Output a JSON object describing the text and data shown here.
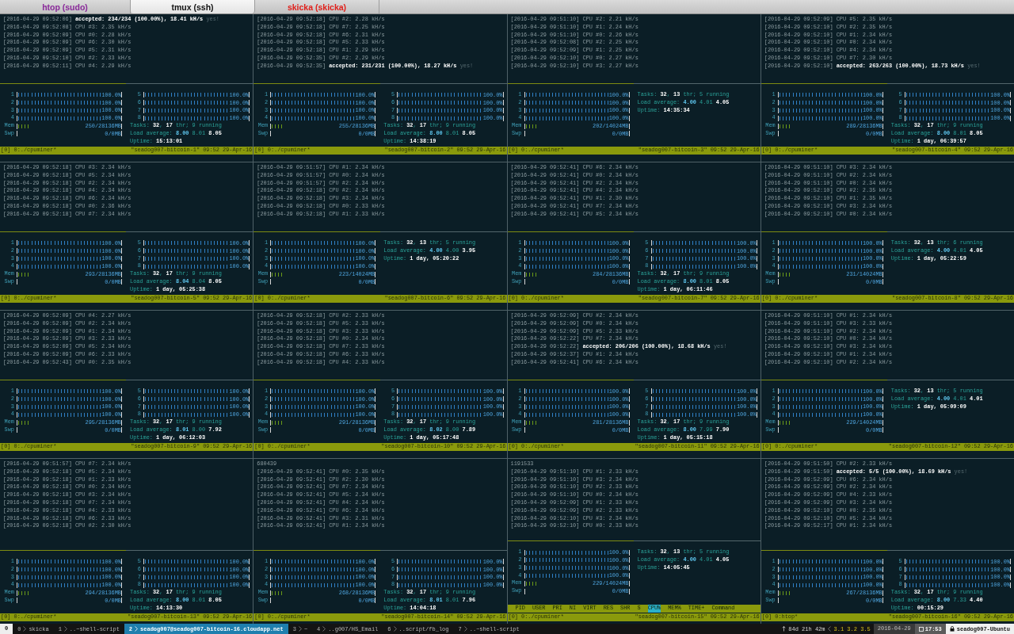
{
  "tabs": [
    {
      "label": "htop (sudo)",
      "selected": false,
      "color": "#8a2a9a"
    },
    {
      "label": "tmux (ssh)",
      "selected": true,
      "color": "#111111"
    },
    {
      "label": "skicka (skicka)",
      "selected": false,
      "color": "#e0201a"
    }
  ],
  "panes": [
    {
      "log": [
        {
          "kind": "accepted",
          "time": "[2016-04-29 09:52:06]",
          "text": "accepted: 234/234 (100.00%), 18.41 kH/s",
          "note": "yes!"
        },
        {
          "kind": "cpu",
          "text": "[2016-04-29 09:52:08] CPU #3: 2.35 kH/s"
        },
        {
          "kind": "cpu",
          "text": "[2016-04-29 09:52:09] CPU #0: 2.28 kH/s"
        },
        {
          "kind": "cpu",
          "text": "[2016-04-29 09:52:09] CPU #6: 2.30 kH/s"
        },
        {
          "kind": "cpu",
          "text": "[2016-04-29 09:52:09] CPU #5: 2.31 kH/s"
        },
        {
          "kind": "cpu",
          "text": "[2016-04-29 09:52:10] CPU #2: 2.33 kH/s"
        },
        {
          "kind": "cpu",
          "text": "[2016-04-29 09:52:11] CPU #4: 2.29 kH/s"
        }
      ],
      "cpus": [
        {
          "label": "1",
          "level": 1,
          "reading": "100.0%"
        },
        {
          "label": "2",
          "level": 1,
          "reading": "100.0%"
        },
        {
          "label": "3",
          "level": 1,
          "reading": "100.0%"
        },
        {
          "label": "4",
          "level": 1,
          "reading": "100.0%"
        },
        {
          "label": "5",
          "level": 1,
          "reading": "100.0%"
        },
        {
          "label": "6",
          "level": 1,
          "reading": "100.0%"
        },
        {
          "label": "7",
          "level": 1,
          "reading": "100.0%"
        },
        {
          "label": "8",
          "level": 1,
          "reading": "100.0%"
        }
      ],
      "mem": {
        "label": "Mem",
        "level": 0.12,
        "reading": "250/28136MB"
      },
      "swap": {
        "label": "Swp",
        "reading": "0/0MB"
      },
      "info": [
        "Tasks: **32**, **17** thr; 9 running",
        "Load average: **8.00** 8.01 **8.05**",
        "Uptime: **15:13:01**"
      ],
      "status_left": "[0] 0:./cpuminer*",
      "status_right": "\"seadog007-bitcoin-1\" 09:52 29-Apr-16"
    },
    {
      "log": [
        {
          "kind": "cpu",
          "text": "[2016-04-29 09:52:18] CPU #2: 2.28 kH/s"
        },
        {
          "kind": "cpu",
          "text": "[2016-04-29 09:52:18] CPU #7: 2.25 kH/s"
        },
        {
          "kind": "cpu",
          "text": "[2016-04-29 09:52:18] CPU #6: 2.31 kH/s"
        },
        {
          "kind": "cpu",
          "text": "[2016-04-29 09:52:18] CPU #5: 2.33 kH/s"
        },
        {
          "kind": "cpu",
          "text": "[2016-04-29 09:52:18] CPU #1: 2.29 kH/s"
        },
        {
          "kind": "cpu",
          "text": "[2016-04-29 09:52:35] CPU #2: 2.29 kH/s"
        },
        {
          "kind": "accepted",
          "time": "[2016-04-29 09:52:35]",
          "text": "accepted: 231/231 (100.00%), 18.27 kH/s",
          "note": "yes!"
        }
      ],
      "cpus": [
        {
          "label": "1",
          "level": 1,
          "reading": "100.0%"
        },
        {
          "label": "2",
          "level": 1,
          "reading": "100.0%"
        },
        {
          "label": "3",
          "level": 1,
          "reading": "100.0%"
        },
        {
          "label": "4",
          "level": 1,
          "reading": "100.0%"
        },
        {
          "label": "5",
          "level": 1,
          "reading": "100.0%"
        },
        {
          "label": "6",
          "level": 1,
          "reading": "100.0%"
        },
        {
          "label": "7",
          "level": 1,
          "reading": "100.0%"
        },
        {
          "label": "8",
          "level": 1,
          "reading": "100.0%"
        }
      ],
      "mem": {
        "label": "Mem",
        "level": 0.12,
        "reading": "255/28136MB"
      },
      "swap": {
        "label": "Swp",
        "reading": "0/0MB"
      },
      "info": [
        "Tasks: **32**, **17** thr; 9 running",
        "Load average: **8.00** 8.01 **8.05**",
        "Uptime: **14:38:19**"
      ],
      "status_left": "[0] 0:./cpuminer*",
      "status_right": "\"seadog007-bitcoin-2\" 09:52 29-Apr-16"
    },
    {
      "log": [
        {
          "kind": "cpu",
          "text": "[2016-04-29 09:51:10] CPU #2: 2.21 kH/s"
        },
        {
          "kind": "cpu",
          "text": "[2016-04-29 09:51:10] CPU #1: 2.24 kH/s"
        },
        {
          "kind": "cpu",
          "text": "[2016-04-29 09:51:10] CPU #0: 2.26 kH/s"
        },
        {
          "kind": "cpu",
          "text": "[2016-04-29 09:52:08] CPU #2: 2.25 kH/s"
        },
        {
          "kind": "cpu",
          "text": "[2016-04-29 09:52:09] CPU #1: 2.25 kH/s"
        },
        {
          "kind": "cpu",
          "text": "[2016-04-29 09:52:10] CPU #0: 2.27 kH/s"
        },
        {
          "kind": "cpu",
          "text": "[2016-04-29 09:52:10] CPU #3: 2.27 kH/s"
        }
      ],
      "cpus": [
        {
          "label": "1",
          "level": 1,
          "reading": "100.0%"
        },
        {
          "label": "2",
          "level": 1,
          "reading": "100.0%"
        },
        {
          "label": "3",
          "level": 1,
          "reading": "100.0%"
        },
        {
          "label": "4",
          "level": 1,
          "reading": "100.0%"
        }
      ],
      "mem": {
        "label": "Mem",
        "level": 0.12,
        "reading": "202/14024MB"
      },
      "swap": {
        "label": "Swp",
        "reading": "0/0MB"
      },
      "info": [
        "Tasks: **32**, **13** thr; 5 running",
        "Load average: **4.00** 4.01 **4.05**",
        "Uptime: **14:35:34**"
      ],
      "status_left": "[0] 0:./cpuminer*",
      "status_right": "\"seadog007-bitcoin-3\" 09:52 29-Apr-16"
    },
    {
      "log": [
        {
          "kind": "cpu",
          "text": "[2016-04-29 09:52:09] CPU #5: 2.35 kH/s"
        },
        {
          "kind": "cpu",
          "text": "[2016-04-29 09:52:10] CPU #2: 2.35 kH/s"
        },
        {
          "kind": "cpu",
          "text": "[2016-04-29 09:52:10] CPU #1: 2.34 kH/s"
        },
        {
          "kind": "cpu",
          "text": "[2016-04-29 09:52:10] CPU #0: 2.34 kH/s"
        },
        {
          "kind": "cpu",
          "text": "[2016-04-29 09:52:10] CPU #4: 2.34 kH/s"
        },
        {
          "kind": "cpu",
          "text": "[2016-04-29 09:52:10] CPU #7: 2.30 kH/s"
        },
        {
          "kind": "accepted",
          "time": "[2016-04-29 09:52:10]",
          "text": "accepted: 263/263 (100.00%), 18.73 kH/s",
          "note": "yes!"
        }
      ],
      "cpus": [
        {
          "label": "1",
          "level": 1,
          "reading": "100.0%"
        },
        {
          "label": "2",
          "level": 1,
          "reading": "100.0%"
        },
        {
          "label": "3",
          "level": 1,
          "reading": "100.0%"
        },
        {
          "label": "4",
          "level": 1,
          "reading": "100.0%"
        },
        {
          "label": "5",
          "level": 1,
          "reading": "100.0%"
        },
        {
          "label": "6",
          "level": 1,
          "reading": "100.0%"
        },
        {
          "label": "7",
          "level": 1,
          "reading": "100.0%"
        },
        {
          "label": "8",
          "level": 1,
          "reading": "100.0%"
        }
      ],
      "mem": {
        "label": "Mem",
        "level": 0.12,
        "reading": "289/28136MB"
      },
      "swap": {
        "label": "Swp",
        "reading": "0/0MB"
      },
      "info": [
        "Tasks: **32**, **17** thr; 9 running",
        "Load average: **8.00** 8.01 **8.05**",
        "Uptime: **1 day, 06:39:57**"
      ],
      "status_left": "[0] 0:./cpuminer*",
      "status_right": "\"seadog007-bitcoin-4\" 09:52 29-Apr-16"
    },
    {
      "log": [
        {
          "kind": "cpu",
          "text": "[2016-04-29 09:52:18] CPU #3: 2.34 kH/s"
        },
        {
          "kind": "cpu",
          "text": "[2016-04-29 09:52:18] CPU #5: 2.34 kH/s"
        },
        {
          "kind": "cpu",
          "text": "[2016-04-29 09:52:18] CPU #2: 2.34 kH/s"
        },
        {
          "kind": "cpu",
          "text": "[2016-04-29 09:52:18] CPU #4: 2.34 kH/s"
        },
        {
          "kind": "cpu",
          "text": "[2016-04-29 09:52:18] CPU #6: 2.34 kH/s"
        },
        {
          "kind": "cpu",
          "text": "[2016-04-29 09:52:18] CPU #0: 2.36 kH/s"
        },
        {
          "kind": "cpu",
          "text": "[2016-04-29 09:52:18] CPU #7: 2.34 kH/s"
        }
      ],
      "cpus": [
        {
          "label": "1",
          "level": 1,
          "reading": "100.0%"
        },
        {
          "label": "2",
          "level": 1,
          "reading": "100.0%"
        },
        {
          "label": "3",
          "level": 1,
          "reading": "100.0%"
        },
        {
          "label": "4",
          "level": 1,
          "reading": "100.0%"
        },
        {
          "label": "5",
          "level": 1,
          "reading": "100.0%"
        },
        {
          "label": "6",
          "level": 1,
          "reading": "100.0%"
        },
        {
          "label": "7",
          "level": 1,
          "reading": "100.0%"
        },
        {
          "label": "8",
          "level": 1,
          "reading": "100.0%"
        }
      ],
      "mem": {
        "label": "Mem",
        "level": 0.12,
        "reading": "293/28136MB"
      },
      "swap": {
        "label": "Swp",
        "reading": "0/0MB"
      },
      "info": [
        "Tasks: **32**, **17** thr; 9 running",
        "Load average: **8.04** 8.04 **8.05**",
        "Uptime: **1 day, 05:25:38**"
      ],
      "status_left": "[0] 0:./cpuminer*",
      "status_right": "\"seadog007-bitcoin-5\" 09:52 29-Apr-16"
    },
    {
      "log": [
        {
          "kind": "cpu",
          "text": "[2016-04-29 09:51:57] CPU #1: 2.34 kH/s"
        },
        {
          "kind": "cpu",
          "text": "[2016-04-29 09:51:57] CPU #0: 2.34 kH/s"
        },
        {
          "kind": "cpu",
          "text": "[2016-04-29 09:51:57] CPU #2: 2.34 kH/s"
        },
        {
          "kind": "cpu",
          "text": "[2016-04-29 09:52:18] CPU #2: 2.34 kH/s"
        },
        {
          "kind": "cpu",
          "text": "[2016-04-29 09:52:18] CPU #3: 2.34 kH/s"
        },
        {
          "kind": "cpu",
          "text": "[2016-04-29 09:52:18] CPU #0: 2.33 kH/s"
        },
        {
          "kind": "cpu",
          "text": "[2016-04-29 09:52:18] CPU #1: 2.33 kH/s"
        }
      ],
      "cpus": [
        {
          "label": "1",
          "level": 1,
          "reading": "100.0%"
        },
        {
          "label": "2",
          "level": 1,
          "reading": "100.0%"
        },
        {
          "label": "3",
          "level": 1,
          "reading": "100.0%"
        },
        {
          "label": "4",
          "level": 1,
          "reading": "100.0%"
        }
      ],
      "mem": {
        "label": "Mem",
        "level": 0.12,
        "reading": "223/14024MB"
      },
      "swap": {
        "label": "Swp",
        "reading": "0/0MB"
      },
      "info": [
        "Tasks: **32**, **13** thr; 5 running",
        "Load average: **4.00** 4.00 **3.95**",
        "Uptime: **1 day, 05:20:22**"
      ],
      "status_left": "[0] 0:./cpuminer*",
      "status_right": "\"seadog007-bitcoin-6\" 09:52 29-Apr-16"
    },
    {
      "log": [
        {
          "kind": "cpu",
          "text": "[2016-04-29 09:52:41] CPU #6: 2.34 kH/s"
        },
        {
          "kind": "cpu",
          "text": "[2016-04-29 09:52:41] CPU #0: 2.34 kH/s"
        },
        {
          "kind": "cpu",
          "text": "[2016-04-29 09:52:41] CPU #2: 2.34 kH/s"
        },
        {
          "kind": "cpu",
          "text": "[2016-04-29 09:52:41] CPU #4: 2.34 kH/s"
        },
        {
          "kind": "cpu",
          "text": "[2016-04-29 09:52:41] CPU #1: 2.30 kH/s"
        },
        {
          "kind": "cpu",
          "text": "[2016-04-29 09:52:41] CPU #7: 2.34 kH/s"
        },
        {
          "kind": "cpu",
          "text": "[2016-04-29 09:52:41] CPU #5: 2.34 kH/s"
        }
      ],
      "cpus": [
        {
          "label": "1",
          "level": 1,
          "reading": "100.0%"
        },
        {
          "label": "2",
          "level": 1,
          "reading": "100.0%"
        },
        {
          "label": "3",
          "level": 1,
          "reading": "100.0%"
        },
        {
          "label": "4",
          "level": 1,
          "reading": "100.0%"
        },
        {
          "label": "5",
          "level": 1,
          "reading": "100.0%"
        },
        {
          "label": "6",
          "level": 1,
          "reading": "100.0%"
        },
        {
          "label": "7",
          "level": 1,
          "reading": "100.0%"
        },
        {
          "label": "8",
          "level": 1,
          "reading": "100.0%"
        }
      ],
      "mem": {
        "label": "Mem",
        "level": 0.12,
        "reading": "284/28136MB"
      },
      "swap": {
        "label": "Swp",
        "reading": "0/0MB"
      },
      "info": [
        "Tasks: **32**, **17** thr; 9 running",
        "Load average: **8.00** 8.01 **8.05**",
        "Uptime: **1 day, 06:11:46**"
      ],
      "status_left": "[0] 0:./cpuminer*",
      "status_right": "\"seadog007-bitcoin-7\" 09:52 29-Apr-16"
    },
    {
      "log": [
        {
          "kind": "cpu",
          "text": "[2016-04-29 09:51:10] CPU #3: 2.34 kH/s"
        },
        {
          "kind": "cpu",
          "text": "[2016-04-29 09:51:10] CPU #2: 2.34 kH/s"
        },
        {
          "kind": "cpu",
          "text": "[2016-04-29 09:51:10] CPU #0: 2.34 kH/s"
        },
        {
          "kind": "cpu",
          "text": "[2016-04-29 09:52:10] CPU #2: 2.35 kH/s"
        },
        {
          "kind": "cpu",
          "text": "[2016-04-29 09:52:10] CPU #1: 2.35 kH/s"
        },
        {
          "kind": "cpu",
          "text": "[2016-04-29 09:52:10] CPU #3: 2.34 kH/s"
        },
        {
          "kind": "cpu",
          "text": "[2016-04-29 09:52:10] CPU #0: 2.34 kH/s"
        }
      ],
      "cpus": [
        {
          "label": "1",
          "level": 1,
          "reading": "100.0%"
        },
        {
          "label": "2",
          "level": 1,
          "reading": "100.0%"
        },
        {
          "label": "3",
          "level": 1,
          "reading": "100.0%"
        },
        {
          "label": "4",
          "level": 1,
          "reading": "100.0%"
        }
      ],
      "mem": {
        "label": "Mem",
        "level": 0.12,
        "reading": "231/14024MB"
      },
      "swap": {
        "label": "Swp",
        "reading": "0/0MB"
      },
      "info": [
        "Tasks: **32**, **13** thr; 6 running",
        "Load average: **4.00** 4.01 **4.05**",
        "Uptime: **1 day, 05:22:59**"
      ],
      "status_left": "[0] 0:./cpuminer*",
      "status_right": "\"seadog007-bitcoin-8\" 09:52 29-Apr-16"
    },
    {
      "log": [
        {
          "kind": "cpu",
          "text": "[2016-04-29 09:52:09] CPU #4: 2.27 kH/s"
        },
        {
          "kind": "cpu",
          "text": "[2016-04-29 09:52:09] CPU #2: 2.34 kH/s"
        },
        {
          "kind": "cpu",
          "text": "[2016-04-29 09:52:09] CPU #1: 2.34 kH/s"
        },
        {
          "kind": "cpu",
          "text": "[2016-04-29 09:52:09] CPU #3: 2.33 kH/s"
        },
        {
          "kind": "cpu",
          "text": "[2016-04-29 09:52:09] CPU #5: 2.34 kH/s"
        },
        {
          "kind": "cpu",
          "text": "[2016-04-29 09:52:09] CPU #6: 2.33 kH/s"
        },
        {
          "kind": "cpu",
          "text": "[2016-04-29 09:52:43] CPU #0: 2.35 kH/s"
        }
      ],
      "cpus": [
        {
          "label": "1",
          "level": 1,
          "reading": "100.0%"
        },
        {
          "label": "2",
          "level": 1,
          "reading": "100.0%"
        },
        {
          "label": "3",
          "level": 1,
          "reading": "100.0%"
        },
        {
          "label": "4",
          "level": 1,
          "reading": "100.0%"
        },
        {
          "label": "5",
          "level": 1,
          "reading": "100.0%"
        },
        {
          "label": "6",
          "level": 1,
          "reading": "100.0%"
        },
        {
          "label": "7",
          "level": 1,
          "reading": "100.0%"
        },
        {
          "label": "8",
          "level": 1,
          "reading": "100.0%"
        }
      ],
      "mem": {
        "label": "Mem",
        "level": 0.12,
        "reading": "295/28136MB"
      },
      "swap": {
        "label": "Swp",
        "reading": "0/0MB"
      },
      "info": [
        "Tasks: **32**, **17** thr; 9 running",
        "Load average: **8.01** 8.00 **7.92**",
        "Uptime: **1 day, 06:12:03**"
      ],
      "status_left": "[0] 0:./cpuminer*",
      "status_right": "\"seadog007-bitcoin-9\" 09:52 29-Apr-16"
    },
    {
      "log": [
        {
          "kind": "cpu",
          "text": "[2016-04-29 09:52:18] CPU #2: 2.33 kH/s"
        },
        {
          "kind": "cpu",
          "text": "[2016-04-29 09:52:18] CPU #5: 2.33 kH/s"
        },
        {
          "kind": "cpu",
          "text": "[2016-04-29 09:52:18] CPU #3: 2.33 kH/s"
        },
        {
          "kind": "cpu",
          "text": "[2016-04-29 09:52:18] CPU #0: 2.34 kH/s"
        },
        {
          "kind": "cpu",
          "text": "[2016-04-29 09:52:18] CPU #7: 2.33 kH/s"
        },
        {
          "kind": "cpu",
          "text": "[2016-04-29 09:52:18] CPU #6: 2.33 kH/s"
        },
        {
          "kind": "cpu",
          "text": "[2016-04-29 09:52:18] CPU #4: 2.33 kH/s"
        }
      ],
      "cpus": [
        {
          "label": "1",
          "level": 1,
          "reading": "100.0%"
        },
        {
          "label": "2",
          "level": 1,
          "reading": "100.0%"
        },
        {
          "label": "3",
          "level": 1,
          "reading": "100.0%"
        },
        {
          "label": "4",
          "level": 1,
          "reading": "100.0%"
        },
        {
          "label": "5",
          "level": 1,
          "reading": "100.0%"
        },
        {
          "label": "6",
          "level": 1,
          "reading": "100.0%"
        },
        {
          "label": "7",
          "level": 1,
          "reading": "100.0%"
        },
        {
          "label": "8",
          "level": 1,
          "reading": "100.0%"
        }
      ],
      "mem": {
        "label": "Mem",
        "level": 0.12,
        "reading": "291/28136MB"
      },
      "swap": {
        "label": "Swp",
        "reading": "0/0MB"
      },
      "info": [
        "Tasks: **32**, **17** thr; 9 running",
        "Load average: **8.02** 8.00 **7.89**",
        "Uptime: **1 day, 05:17:48**"
      ],
      "status_left": "[0] 0:./cpuminer*",
      "status_right": "\"seadog007-bitcoin-10\" 09:52 29-Apr-16"
    },
    {
      "log": [
        {
          "kind": "cpu",
          "text": "[2016-04-29 09:52:09] CPU #2: 2.34 kH/s"
        },
        {
          "kind": "cpu",
          "text": "[2016-04-29 09:52:09] CPU #0: 2.34 kH/s"
        },
        {
          "kind": "cpu",
          "text": "[2016-04-29 09:52:09] CPU #5: 2.33 kH/s"
        },
        {
          "kind": "cpu",
          "text": "[2016-04-29 09:52:22] CPU #7: 2.34 kH/s"
        },
        {
          "kind": "accepted",
          "time": "[2016-04-29 09:52:22]",
          "text": "accepted: 206/206 (100.00%), 18.68 kH/s",
          "note": "yes!"
        },
        {
          "kind": "cpu",
          "text": "[2016-04-29 09:52:37] CPU #1: 2.34 kH/s"
        },
        {
          "kind": "cpu",
          "text": "[2016-04-29 09:52:41] CPU #6: 2.34 kH/s"
        }
      ],
      "cpus": [
        {
          "label": "1",
          "level": 1,
          "reading": "100.0%"
        },
        {
          "label": "2",
          "level": 1,
          "reading": "100.0%"
        },
        {
          "label": "3",
          "level": 1,
          "reading": "100.0%"
        },
        {
          "label": "4",
          "level": 1,
          "reading": "100.0%"
        },
        {
          "label": "5",
          "level": 1,
          "reading": "100.0%"
        },
        {
          "label": "6",
          "level": 1,
          "reading": "100.0%"
        },
        {
          "label": "7",
          "level": 1,
          "reading": "100.0%"
        },
        {
          "label": "8",
          "level": 1,
          "reading": "100.0%"
        }
      ],
      "mem": {
        "label": "Mem",
        "level": 0.12,
        "reading": "281/28136MB"
      },
      "swap": {
        "label": "Swp",
        "reading": "0/0MB"
      },
      "info": [
        "Tasks: **32**, **17** thr; 9 running",
        "Load average: **8.00** 7.99 **7.90**",
        "Uptime: **1 day, 05:15:18**"
      ],
      "status_left": "[0] 0:./cpuminer*",
      "status_right": "\"seadog007-bitcoin-11\" 09:52 29-Apr-16"
    },
    {
      "log": [
        {
          "kind": "cpu",
          "text": "[2016-04-29 09:51:10] CPU #1: 2.34 kH/s"
        },
        {
          "kind": "cpu",
          "text": "[2016-04-29 09:51:10] CPU #3: 2.33 kH/s"
        },
        {
          "kind": "cpu",
          "text": "[2016-04-29 09:51:10] CPU #2: 2.34 kH/s"
        },
        {
          "kind": "cpu",
          "text": "[2016-04-29 09:52:10] CPU #0: 2.34 kH/s"
        },
        {
          "kind": "cpu",
          "text": "[2016-04-29 09:52:10] CPU #3: 2.34 kH/s"
        },
        {
          "kind": "cpu",
          "text": "[2016-04-29 09:52:10] CPU #1: 2.34 kH/s"
        },
        {
          "kind": "cpu",
          "text": "[2016-04-29 09:52:10] CPU #2: 2.34 kH/s"
        }
      ],
      "cpus": [
        {
          "label": "1",
          "level": 1,
          "reading": "100.0%"
        },
        {
          "label": "2",
          "level": 1,
          "reading": "100.0%"
        },
        {
          "label": "3",
          "level": 1,
          "reading": "100.0%"
        },
        {
          "label": "4",
          "level": 1,
          "reading": "100.0%"
        }
      ],
      "mem": {
        "label": "Mem",
        "level": 0.12,
        "reading": "229/14024MB"
      },
      "swap": {
        "label": "Swp",
        "reading": "0/0MB"
      },
      "info": [
        "Tasks: **32**, **13** thr; 5 running",
        "Load average: **4.00** 4.01 **4.01**",
        "Uptime: **1 day, 05:09:09**"
      ],
      "status_left": "[0] 0:./cpuminer*",
      "status_right": "\"seadog007-bitcoin-12\" 09:52 29-Apr-16"
    },
    {
      "log": [
        {
          "kind": "cpu",
          "text": "[2016-04-29 09:51:57] CPU #7: 2.34 kH/s"
        },
        {
          "kind": "cpu",
          "text": "[2016-04-29 09:52:18] CPU #5: 2.34 kH/s"
        },
        {
          "kind": "cpu",
          "text": "[2016-04-29 09:52:18] CPU #1: 2.33 kH/s"
        },
        {
          "kind": "cpu",
          "text": "[2016-04-29 09:52:18] CPU #0: 2.34 kH/s"
        },
        {
          "kind": "cpu",
          "text": "[2016-04-29 09:52:18] CPU #3: 2.34 kH/s"
        },
        {
          "kind": "cpu",
          "text": "[2016-04-29 09:52:18] CPU #7: 2.34 kH/s"
        },
        {
          "kind": "cpu",
          "text": "[2016-04-29 09:52:18] CPU #4: 2.33 kH/s"
        },
        {
          "kind": "cpu",
          "text": "[2016-04-29 09:52:18] CPU #6: 2.33 kH/s"
        },
        {
          "kind": "cpu",
          "text": "[2016-04-29 09:52:18] CPU #2: 2.30 kH/s"
        }
      ],
      "cpus": [
        {
          "label": "1",
          "level": 1,
          "reading": "100.0%"
        },
        {
          "label": "2",
          "level": 1,
          "reading": "100.0%"
        },
        {
          "label": "3",
          "level": 1,
          "reading": "100.0%"
        },
        {
          "label": "4",
          "level": 1,
          "reading": "100.0%"
        },
        {
          "label": "5",
          "level": 1,
          "reading": "100.0%"
        },
        {
          "label": "6",
          "level": 1,
          "reading": "100.0%"
        },
        {
          "label": "7",
          "level": 1,
          "reading": "100.0%"
        },
        {
          "label": "8",
          "level": 1,
          "reading": "100.0%"
        }
      ],
      "mem": {
        "label": "Mem",
        "level": 0.12,
        "reading": "294/28136MB"
      },
      "swap": {
        "label": "Swp",
        "reading": "0/0MB"
      },
      "info": [
        "Tasks: **32**, **17** thr; 9 running",
        "Load average: **8.00** 8.01 **8.05**",
        "Uptime: **14:13:30**"
      ],
      "status_left": "[0] 0:./cpuminer*",
      "status_right": "\"seadog007-bitcoin-13\" 09:52 29-Apr-16"
    },
    {
      "log": [
        {
          "kind": "plain",
          "text": "680439"
        },
        {
          "kind": "cpu",
          "text": "[2016-04-29 09:52:41] CPU #0: 2.35 kH/s"
        },
        {
          "kind": "cpu",
          "text": "[2016-04-29 09:52:41] CPU #2: 2.30 kH/s"
        },
        {
          "kind": "cpu",
          "text": "[2016-04-29 09:52:41] CPU #7: 2.34 kH/s"
        },
        {
          "kind": "cpu",
          "text": "[2016-04-29 09:52:41] CPU #5: 2.34 kH/s"
        },
        {
          "kind": "cpu",
          "text": "[2016-04-29 09:52:41] CPU #4: 2.34 kH/s"
        },
        {
          "kind": "cpu",
          "text": "[2016-04-29 09:52:41] CPU #6: 2.34 kH/s"
        },
        {
          "kind": "cpu",
          "text": "[2016-04-29 09:52:41] CPU #3: 2.31 kH/s"
        },
        {
          "kind": "cpu",
          "text": "[2016-04-29 09:52:41] CPU #1: 2.34 kH/s"
        }
      ],
      "cpus": [
        {
          "label": "1",
          "level": 1,
          "reading": "100.0%"
        },
        {
          "label": "2",
          "level": 1,
          "reading": "100.0%"
        },
        {
          "label": "3",
          "level": 1,
          "reading": "100.0%"
        },
        {
          "label": "4",
          "level": 1,
          "reading": "100.0%"
        },
        {
          "label": "5",
          "level": 1,
          "reading": "100.0%"
        },
        {
          "label": "6",
          "level": 1,
          "reading": "100.0%"
        },
        {
          "label": "7",
          "level": 1,
          "reading": "100.0%"
        },
        {
          "label": "8",
          "level": 1,
          "reading": "100.0%"
        }
      ],
      "mem": {
        "label": "Mem",
        "level": 0.12,
        "reading": "268/28136MB"
      },
      "swap": {
        "label": "Swp",
        "reading": "0/0MB"
      },
      "info": [
        "Tasks: **32**, **17** thr; 9 running",
        "Load average: **8.01** 8.01 **7.96**",
        "Uptime: **14:04:18**"
      ],
      "status_left": "[0] 0:./cpuminer*",
      "status_right": "\"seadog007-bitcoin-14\" 09:52 29-Apr-16"
    },
    {
      "log": [
        {
          "kind": "plain",
          "text": "1191533"
        },
        {
          "kind": "cpu",
          "text": "[2016-04-29 09:51:10] CPU #1: 2.33 kH/s"
        },
        {
          "kind": "cpu",
          "text": "[2016-04-29 09:51:10] CPU #3: 2.34 kH/s"
        },
        {
          "kind": "cpu",
          "text": "[2016-04-29 09:51:10] CPU #2: 2.33 kH/s"
        },
        {
          "kind": "cpu",
          "text": "[2016-04-29 09:51:10] CPU #0: 2.34 kH/s"
        },
        {
          "kind": "cpu",
          "text": "[2016-04-29 09:52:09] CPU #1: 2.33 kH/s"
        },
        {
          "kind": "cpu",
          "text": "[2016-04-29 09:52:09] CPU #2: 2.33 kH/s"
        },
        {
          "kind": "cpu",
          "text": "[2016-04-29 09:52:10] CPU #3: 2.34 kH/s"
        },
        {
          "kind": "cpu",
          "text": "[2016-04-29 09:52:10] CPU #0: 2.33 kH/s"
        }
      ],
      "cpus": [
        {
          "label": "1",
          "level": 1,
          "reading": "100.0%"
        },
        {
          "label": "2",
          "level": 1,
          "reading": "100.0%"
        },
        {
          "label": "3",
          "level": 1,
          "reading": "100.0%"
        },
        {
          "label": "4",
          "level": 1,
          "reading": "100.0%"
        }
      ],
      "mem": {
        "label": "Mem",
        "level": 0.12,
        "reading": "229/14024MB"
      },
      "swap": {
        "label": "Swp",
        "reading": "0/0MB"
      },
      "info": [
        "Tasks: **32**, **13** thr; 5 running",
        "Load average: **4.00** 4.01 **4.05**",
        "Uptime: **14:05:45**"
      ],
      "process_header": [
        {
          "label": "PID",
          "selected": false
        },
        {
          "label": "USER",
          "selected": false
        },
        {
          "label": "PRI",
          "selected": false
        },
        {
          "label": "NI",
          "selected": false
        },
        {
          "label": "VIRT",
          "selected": false
        },
        {
          "label": "RES",
          "selected": false
        },
        {
          "label": "SHR",
          "selected": false
        },
        {
          "label": "S",
          "selected": false
        },
        {
          "label": "CPU%",
          "selected": true
        },
        {
          "label": "MEM%",
          "selected": false
        },
        {
          "label": "TIME+",
          "selected": false
        },
        {
          "label": "Command",
          "selected": false
        }
      ],
      "status_left": "[0] 0:./cpuminer*",
      "status_right": "\"seadog007-bitcoin-15\" 09:52 29-Apr-16"
    },
    {
      "log": [
        {
          "kind": "cpu",
          "text": "[2016-04-29 09:51:50] CPU #2: 2.33 kH/s"
        },
        {
          "kind": "accepted",
          "time": "[2016-04-29 09:51:50]",
          "text": "accepted: 5/5 (100.00%), 18.69 kH/s",
          "note": "yes!"
        },
        {
          "kind": "cpu",
          "text": "[2016-04-29 09:52:09] CPU #6: 2.34 kH/s"
        },
        {
          "kind": "cpu",
          "text": "[2016-04-29 09:52:09] CPU #2: 2.34 kH/s"
        },
        {
          "kind": "cpu",
          "text": "[2016-04-29 09:52:09] CPU #4: 2.33 kH/s"
        },
        {
          "kind": "cpu",
          "text": "[2016-04-29 09:52:09] CPU #3: 2.34 kH/s"
        },
        {
          "kind": "cpu",
          "text": "[2016-04-29 09:52:10] CPU #0: 2.35 kH/s"
        },
        {
          "kind": "cpu",
          "text": "[2016-04-29 09:52:10] CPU #5: 2.34 kH/s"
        },
        {
          "kind": "cpu",
          "text": "[2016-04-29 09:52:17] CPU #1: 2.34 kH/s"
        }
      ],
      "cpus": [
        {
          "label": "1",
          "level": 1,
          "reading": "100.0%"
        },
        {
          "label": "2",
          "level": 1,
          "reading": "100.0%"
        },
        {
          "label": "3",
          "level": 1,
          "reading": "100.0%"
        },
        {
          "label": "4",
          "level": 1,
          "reading": "100.0%"
        },
        {
          "label": "5",
          "level": 1,
          "reading": "100.0%"
        },
        {
          "label": "6",
          "level": 1,
          "reading": "100.0%"
        },
        {
          "label": "7",
          "level": 1,
          "reading": "100.0%"
        },
        {
          "label": "8",
          "level": 1,
          "reading": "100.0%"
        }
      ],
      "mem": {
        "label": "Mem",
        "level": 0.12,
        "reading": "267/28136MB"
      },
      "swap": {
        "label": "Swp",
        "reading": "0/0MB"
      },
      "info": [
        "Tasks: **32**, **17** thr; 9 running",
        "Load average: **8.00** 7.33 **4.40**",
        "Uptime: **00:15:29**"
      ],
      "status_left": "[0] 0:htop*",
      "status_right": "\"seadog007-bitcoin-16\" 09:52 29-Apr-16"
    }
  ],
  "bottom_bar": {
    "session": "0",
    "windows": [
      {
        "index": "0",
        "name": "skicka",
        "selected": false
      },
      {
        "index": "1",
        "name": "..~shell-script",
        "selected": false
      },
      {
        "index": "2",
        "name": "seadog007@seadog007-bitcoin-16.cloudapp.net",
        "selected": true
      },
      {
        "index": "3",
        "name": "~",
        "selected": false
      },
      {
        "index": "4",
        "name": "..g007/HS_Email",
        "selected": false
      },
      {
        "index": "6",
        "name": "..script/fb_log",
        "selected": false
      },
      {
        "index": "7",
        "name": "..~shell-script",
        "selected": false
      }
    ],
    "uptime": "84d 21h 42m",
    "load": "3.1 3.2 3.5",
    "date": "2016-04-29",
    "time": "17:53",
    "host": "seadog007-Ubuntu"
  }
}
